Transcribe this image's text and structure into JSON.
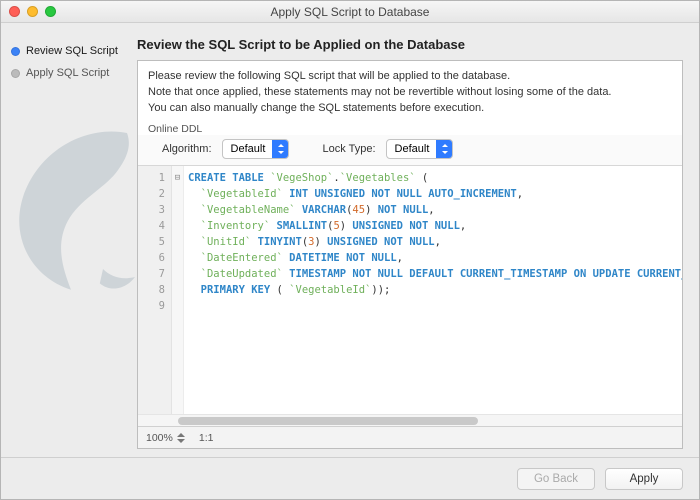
{
  "window": {
    "title": "Apply SQL Script to Database"
  },
  "sidebar": {
    "steps": [
      {
        "label": "Review SQL Script",
        "active": true
      },
      {
        "label": "Apply SQL Script",
        "active": false
      }
    ]
  },
  "heading": "Review the SQL Script to be Applied on the Database",
  "description": {
    "line1": "Please review the following SQL script that will be applied to the database.",
    "line2": "Note that once applied, these statements may not be revertible without losing some of the data.",
    "line3": "You can also manually change the SQL statements before execution."
  },
  "online_ddl": {
    "title": "Online DDL",
    "algorithm_label": "Algorithm:",
    "algorithm_value": "Default",
    "lock_label": "Lock Type:",
    "lock_value": "Default"
  },
  "code_lines": [
    [
      {
        "t": "CREATE TABLE",
        "c": "kw"
      },
      {
        "t": " "
      },
      {
        "t": "`VegeShop`",
        "c": "ident"
      },
      {
        "t": "."
      },
      {
        "t": "`Vegetables`",
        "c": "ident"
      },
      {
        "t": " ("
      }
    ],
    [
      {
        "t": "  "
      },
      {
        "t": "`VegetableId`",
        "c": "ident"
      },
      {
        "t": " "
      },
      {
        "t": "INT UNSIGNED NOT NULL AUTO_INCREMENT",
        "c": "kw"
      },
      {
        "t": ","
      }
    ],
    [
      {
        "t": "  "
      },
      {
        "t": "`VegetableName`",
        "c": "ident"
      },
      {
        "t": " "
      },
      {
        "t": "VARCHAR",
        "c": "kw"
      },
      {
        "t": "("
      },
      {
        "t": "45",
        "c": "num"
      },
      {
        "t": ") "
      },
      {
        "t": "NOT NULL",
        "c": "kw"
      },
      {
        "t": ","
      }
    ],
    [
      {
        "t": "  "
      },
      {
        "t": "`Inventory`",
        "c": "ident"
      },
      {
        "t": " "
      },
      {
        "t": "SMALLINT",
        "c": "kw"
      },
      {
        "t": "("
      },
      {
        "t": "5",
        "c": "num"
      },
      {
        "t": ") "
      },
      {
        "t": "UNSIGNED NOT NULL",
        "c": "kw"
      },
      {
        "t": ","
      }
    ],
    [
      {
        "t": "  "
      },
      {
        "t": "`UnitId`",
        "c": "ident"
      },
      {
        "t": " "
      },
      {
        "t": "TINYINT",
        "c": "kw"
      },
      {
        "t": "("
      },
      {
        "t": "3",
        "c": "num"
      },
      {
        "t": ") "
      },
      {
        "t": "UNSIGNED NOT NULL",
        "c": "kw"
      },
      {
        "t": ","
      }
    ],
    [
      {
        "t": "  "
      },
      {
        "t": "`DateEntered`",
        "c": "ident"
      },
      {
        "t": " "
      },
      {
        "t": "DATETIME NOT NULL",
        "c": "kw"
      },
      {
        "t": ","
      }
    ],
    [
      {
        "t": "  "
      },
      {
        "t": "`DateUpdated`",
        "c": "ident"
      },
      {
        "t": " "
      },
      {
        "t": "TIMESTAMP NOT NULL DEFAULT CURRENT_TIMESTAMP ON UPDATE CURRENT_TIMESTAMP",
        "c": "kw"
      }
    ],
    [
      {
        "t": "  "
      },
      {
        "t": "PRIMARY KEY",
        "c": "kw"
      },
      {
        "t": " ("
      },
      {
        "t": " `VegetableId`",
        "c": "ident"
      },
      {
        "t": "));"
      }
    ],
    [
      {
        "t": ""
      }
    ]
  ],
  "status": {
    "zoom": "100%",
    "ratio": "1:1"
  },
  "footer": {
    "back": "Go Back",
    "apply": "Apply"
  }
}
